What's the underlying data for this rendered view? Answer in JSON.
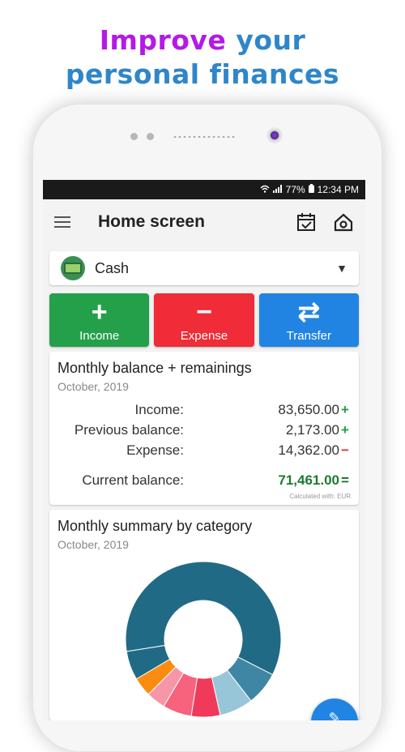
{
  "headline": {
    "line1_part1": "Improve",
    "line1_part2": " your",
    "line2": "personal finances"
  },
  "status_bar": {
    "wifi_icon": "wifi-icon",
    "signal_icon": "signal-icon",
    "battery": "77%",
    "time": "12:34 PM"
  },
  "app_bar": {
    "title": "Home screen",
    "menu_icon": "hamburger-menu-icon",
    "calendar_icon": "calendar-check-icon",
    "settings_icon": "house-gear-icon"
  },
  "account": {
    "name": "Cash",
    "icon": "wallet-icon"
  },
  "actions": [
    {
      "label": "Income",
      "glyph": "+",
      "color": "#25a04a"
    },
    {
      "label": "Expense",
      "glyph": "−",
      "color": "#ef2c37"
    },
    {
      "label": "Transfer",
      "glyph": "⇄",
      "color": "#2184e3"
    }
  ],
  "balance_card": {
    "title": "Monthly balance + remainings",
    "period": "October, 2019",
    "rows": [
      {
        "label": "Income:",
        "value": "83,650.00",
        "sign": "+"
      },
      {
        "label": "Previous balance:",
        "value": "2,173.00",
        "sign": "+"
      },
      {
        "label": "Expense:",
        "value": "14,362.00",
        "sign": "−"
      }
    ],
    "total": {
      "label": "Current balance:",
      "value": "71,461.00",
      "sign": "="
    },
    "note": "Calculated with: EUR"
  },
  "summary_card": {
    "title": "Monthly summary by category",
    "period": "October, 2019"
  },
  "chart_data": {
    "type": "pie",
    "slices": [
      {
        "value": 60,
        "color": "#216a85"
      },
      {
        "value": 7,
        "color": "#3f86a5"
      },
      {
        "value": 7,
        "color": "#97c6d8"
      },
      {
        "value": 6,
        "color": "#ef3a5b"
      },
      {
        "value": 6,
        "color": "#f7627d"
      },
      {
        "value": 4,
        "color": "#f796a6"
      },
      {
        "value": 4,
        "color": "#fb8c0f"
      },
      {
        "value": 6,
        "color": "#216a85"
      }
    ]
  },
  "fab": {
    "icon": "pencil-icon"
  }
}
